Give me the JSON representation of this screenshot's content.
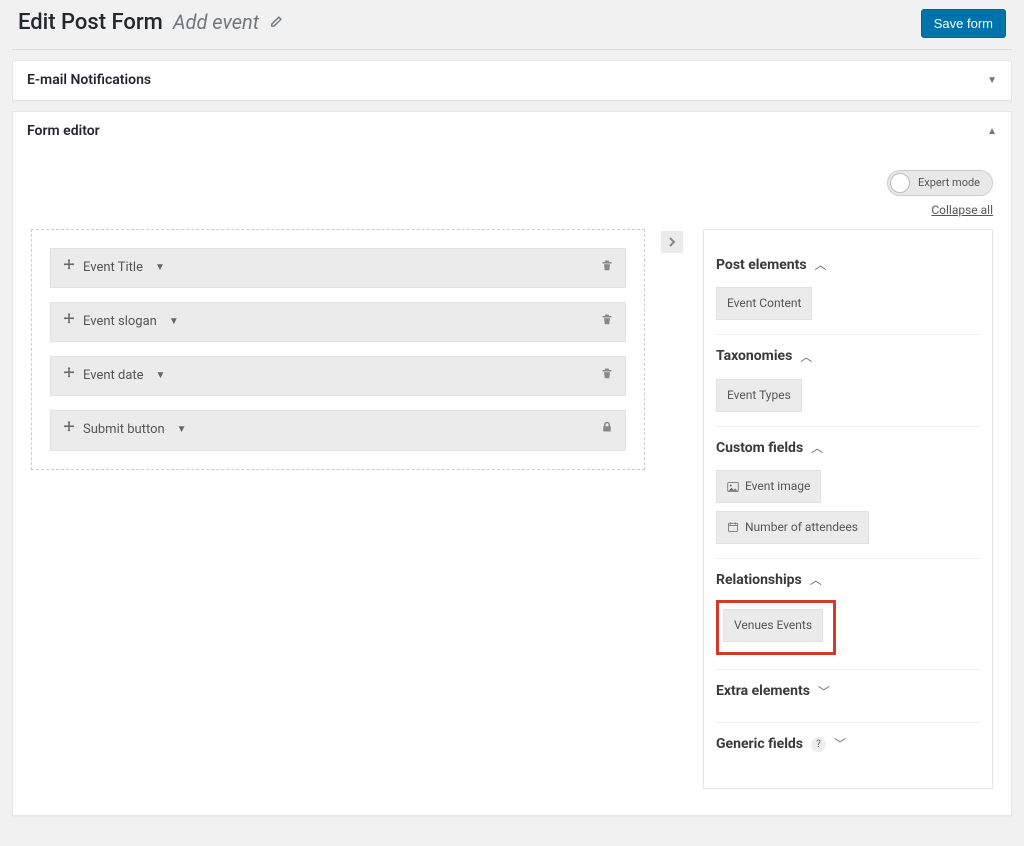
{
  "header": {
    "page_title": "Edit Post Form",
    "form_name": "Add event",
    "save_label": "Save form"
  },
  "panels": {
    "email": {
      "title": "E-mail Notifications",
      "collapsed": true
    },
    "form_editor": {
      "title": "Form editor",
      "expert_mode_label": "Expert mode",
      "collapse_all_label": "Collapse all"
    }
  },
  "canvas": {
    "fields": [
      {
        "label": "Event Title",
        "locked": false
      },
      {
        "label": "Event slogan",
        "locked": false
      },
      {
        "label": "Event date",
        "locked": false
      },
      {
        "label": "Submit button",
        "locked": true
      }
    ]
  },
  "sidebar": {
    "sections": [
      {
        "title": "Post elements",
        "open": true,
        "items": [
          {
            "label": "Event Content"
          }
        ]
      },
      {
        "title": "Taxonomies",
        "open": true,
        "items": [
          {
            "label": "Event Types"
          }
        ]
      },
      {
        "title": "Custom fields",
        "open": true,
        "items": [
          {
            "label": "Event image",
            "icon": "image"
          },
          {
            "label": "Number of attendees",
            "icon": "calendar"
          }
        ]
      },
      {
        "title": "Relationships",
        "open": true,
        "highlighted": true,
        "items": [
          {
            "label": "Venues Events"
          }
        ]
      },
      {
        "title": "Extra elements",
        "open": false
      },
      {
        "title": "Generic fields",
        "open": false,
        "help": true
      }
    ]
  }
}
